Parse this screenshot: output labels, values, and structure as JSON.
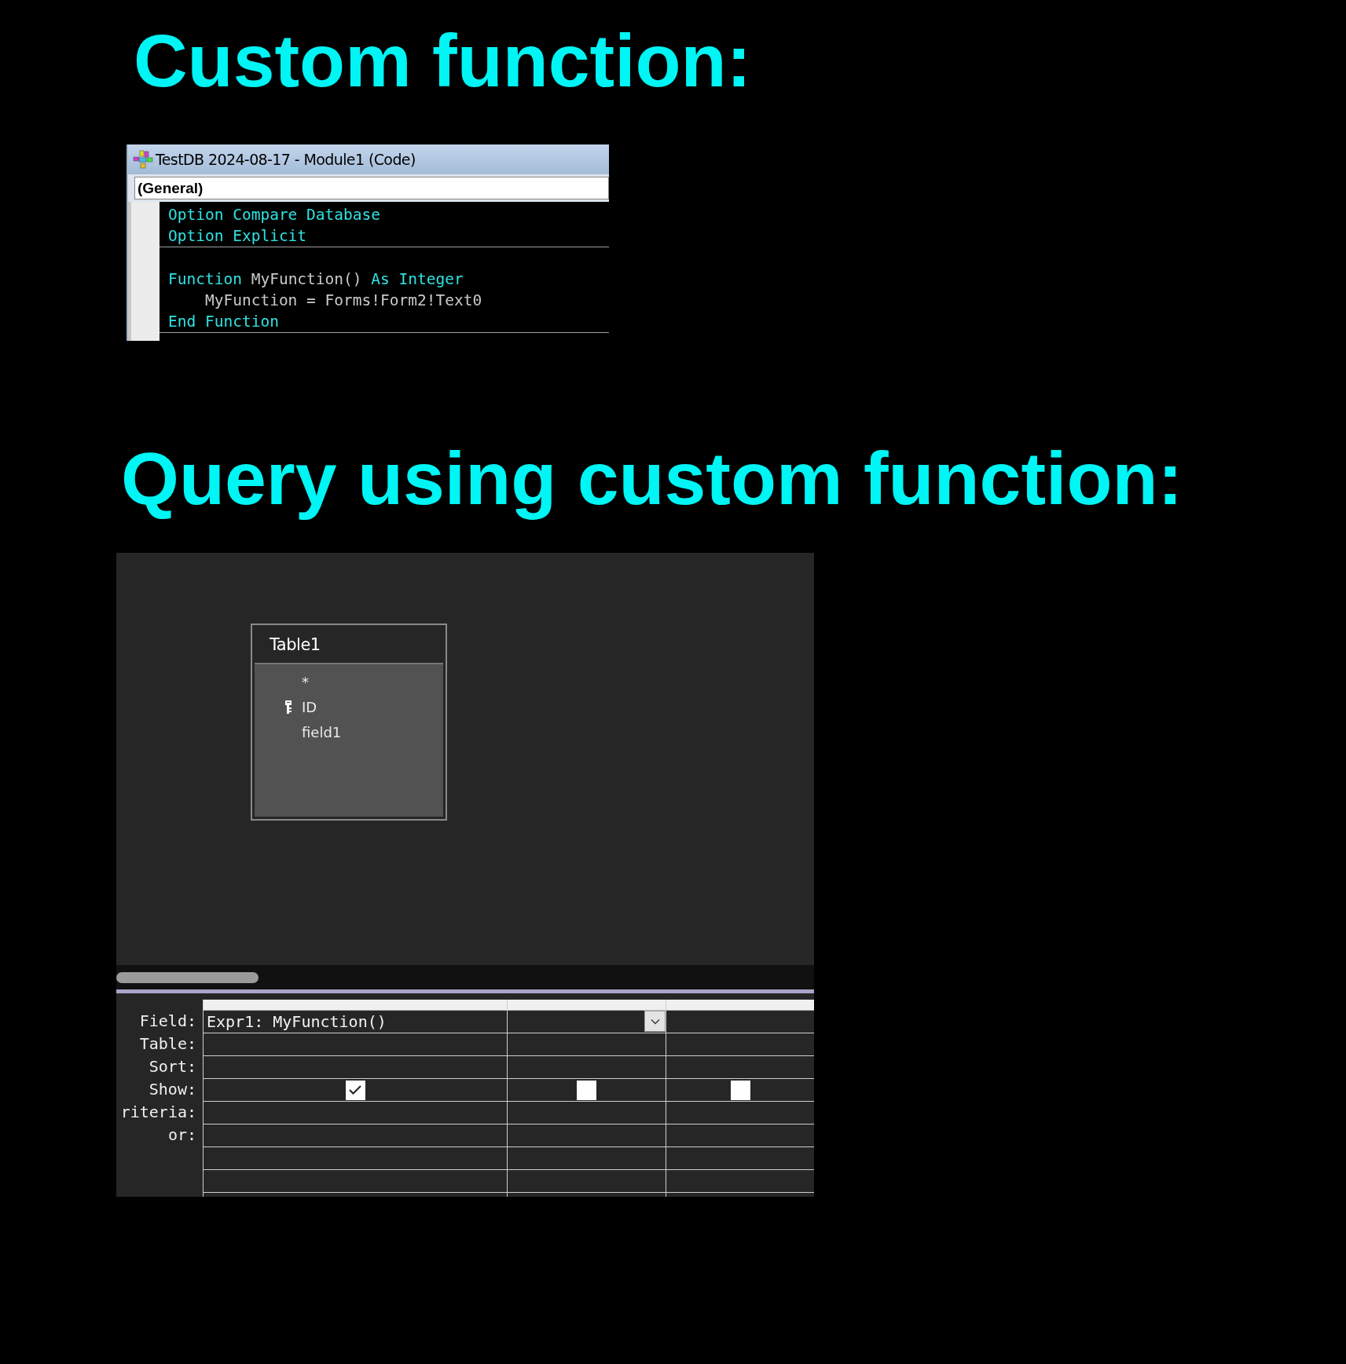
{
  "heading_1": "Custom function:",
  "code_window": {
    "title": "TestDB 2024-08-17 - Module1 (Code)",
    "object_box": "(General)",
    "procedures": [
      {
        "lines": [
          [
            {
              "text": "Option Compare Database",
              "kind": "keyword"
            }
          ],
          [
            {
              "text": "Option Explicit",
              "kind": "keyword"
            }
          ]
        ]
      },
      {
        "lines": [
          [
            {
              "text": "Function ",
              "kind": "keyword"
            },
            {
              "text": "MyFunction() ",
              "kind": "plain"
            },
            {
              "text": "As Integer",
              "kind": "keyword"
            }
          ],
          [
            {
              "text": "    MyFunction = Forms!Form2!Text0",
              "kind": "plain"
            }
          ],
          [
            {
              "text": "End Function",
              "kind": "keyword"
            }
          ]
        ]
      }
    ]
  },
  "heading_2": "Query using custom function:",
  "query_design": {
    "table": {
      "title": "Table1",
      "fields": [
        {
          "name": "*",
          "key": false
        },
        {
          "name": "ID",
          "key": true
        },
        {
          "name": "field1",
          "key": false
        }
      ]
    },
    "row_labels": [
      "Field:",
      "Table:",
      "Sort:",
      "Show:",
      "riteria:",
      "or:"
    ],
    "columns": [
      {
        "field": "Expr1: MyFunction()",
        "show": true,
        "focused": false
      },
      {
        "show": false,
        "focused": true
      },
      {
        "show": false,
        "focused": false
      }
    ]
  }
}
